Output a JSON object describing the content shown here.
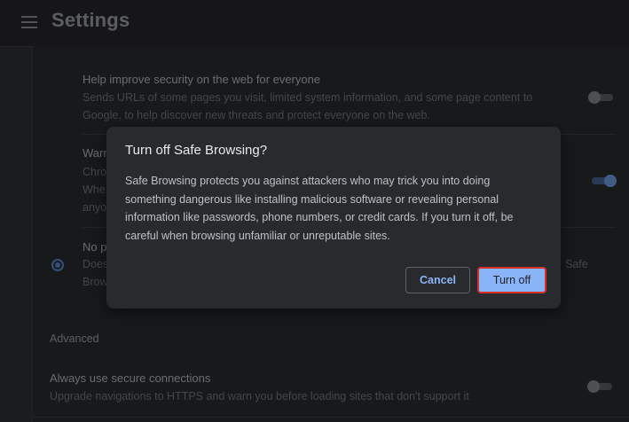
{
  "header": {
    "title": "Settings"
  },
  "settings": {
    "help_improve": {
      "title": "Help improve security on the web for everyone",
      "desc_line1": "Sends URLs of some pages you visit, limited system information, and some page content to",
      "desc_line2": "Google, to help discover new threats and protect everyone on the web.",
      "enabled": false
    },
    "warn_row": {
      "title_partial": "Warn",
      "desc_partial1": "Chro",
      "desc_partial2": "Whe",
      "desc_partial3": "anyo",
      "enabled": true
    },
    "no_protection": {
      "title_partial": "No p",
      "desc_partial1": "Does",
      "desc_partial2": "Brow",
      "desc_right": "Safe",
      "selected": true
    },
    "advanced_label": "Advanced",
    "secure_connections": {
      "title": "Always use secure connections",
      "desc": "Upgrade navigations to HTTPS and warn you before loading sites that don't support it",
      "enabled": false
    }
  },
  "dialog": {
    "title": "Turn off Safe Browsing?",
    "body": "Safe Browsing protects you against attackers who may trick you into doing something dangerous like installing malicious software or revealing personal information like passwords, phone numbers, or credit cards. If you turn it off, be careful when browsing unfamiliar or unreputable sites.",
    "cancel_label": "Cancel",
    "confirm_label": "Turn off"
  },
  "colors": {
    "accent": "#8ab4f8",
    "highlight_border": "#d93025",
    "dialog_bg": "#292a2d"
  }
}
